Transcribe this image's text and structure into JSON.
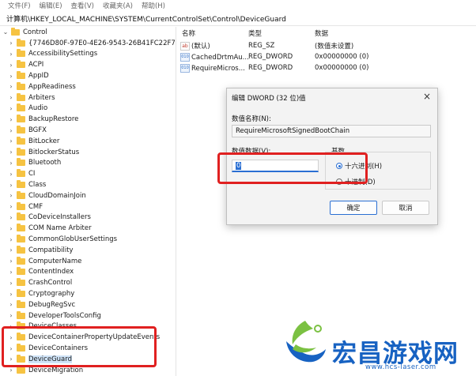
{
  "menu": [
    "文件(F)",
    "编辑(E)",
    "查看(V)",
    "收藏夹(A)",
    "帮助(H)"
  ],
  "address": "计算机\\HKEY_LOCAL_MACHINE\\SYSTEM\\CurrentControlSet\\Control\\DeviceGuard",
  "tree": {
    "root": "Control",
    "items": [
      "{7746D80F-97E0-4E26-9543-26B41FC22F79}",
      "AccessibilitySettings",
      "ACPI",
      "AppID",
      "AppReadiness",
      "Arbiters",
      "Audio",
      "BackupRestore",
      "BGFX",
      "BitLocker",
      "BitlockerStatus",
      "Bluetooth",
      "CI",
      "Class",
      "CloudDomainJoin",
      "CMF",
      "CoDeviceInstallers",
      "COM Name Arbiter",
      "CommonGlobUserSettings",
      "Compatibility",
      "ComputerName",
      "ContentIndex",
      "CrashControl",
      "Cryptography",
      "DebugRegSvc",
      "DeveloperToolsConfig",
      "DeviceClasses",
      "DeviceContainerPropertyUpdateEvents",
      "DeviceContainers",
      "DeviceGuard",
      "DeviceMigration"
    ]
  },
  "values": {
    "headers": {
      "name": "名称",
      "type": "类型",
      "data": "数据"
    },
    "rows": [
      {
        "icon": "ab",
        "name": "(默认)",
        "type": "REG_SZ",
        "data": "(数值未设置)"
      },
      {
        "icon": "dword",
        "name": "CachedDrtmAu...",
        "type": "REG_DWORD",
        "data": "0x00000000 (0)"
      },
      {
        "icon": "dword",
        "name": "RequireMicros...",
        "type": "REG_DWORD",
        "data": "0x00000000 (0)"
      }
    ]
  },
  "dialog": {
    "title": "编辑 DWORD (32 位)值",
    "close": "×",
    "name_label": "数值名称(N):",
    "name_value": "RequireMicrosoftSignedBootChain",
    "data_label": "数值数据(V):",
    "data_value": "0",
    "base_label": "基数",
    "radio_hex": "十六进制(H)",
    "radio_dec": "十进制(D)",
    "ok": "确定",
    "cancel": "取消"
  },
  "watermark": {
    "text": "宏昌游戏网",
    "url": "www.hcs-laser.com"
  },
  "colors": {
    "highlight": "#e02020",
    "accent": "#2a6fd3",
    "folder": "#f6c342"
  }
}
